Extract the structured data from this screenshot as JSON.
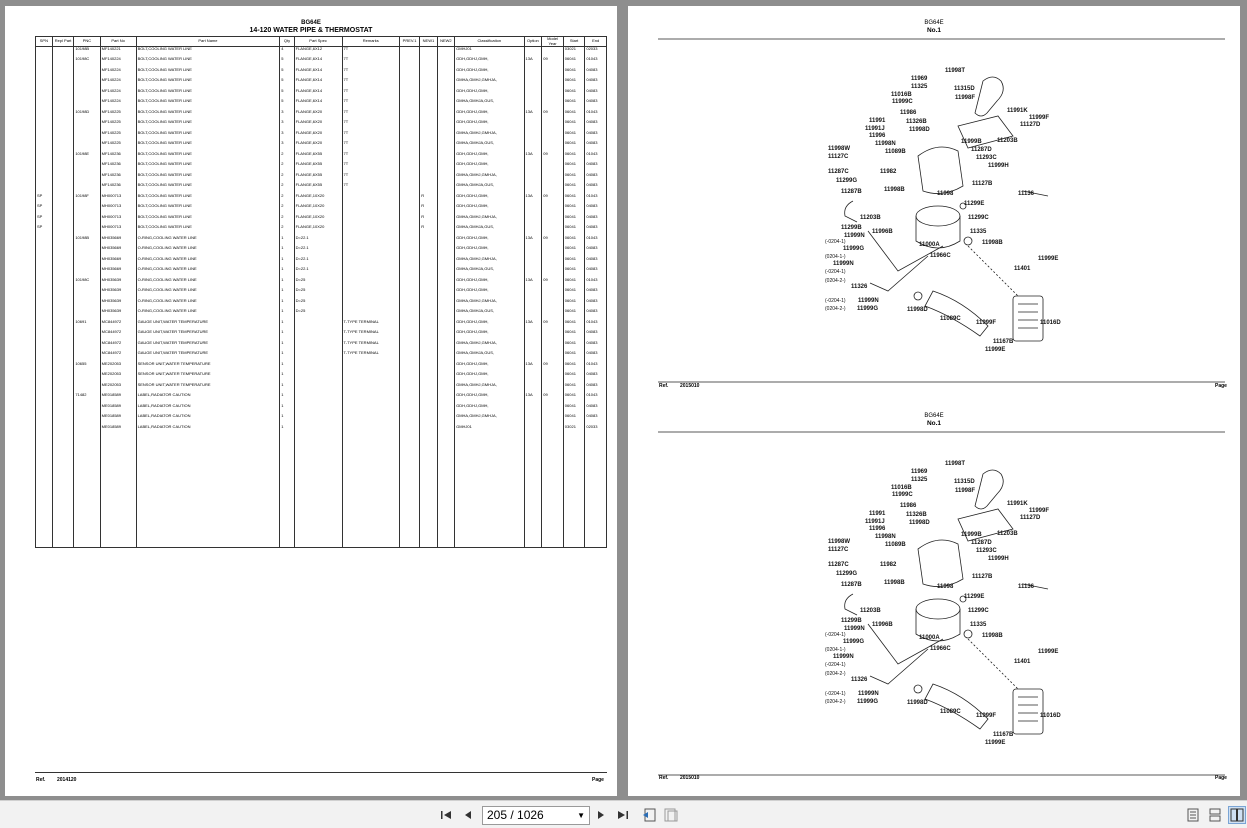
{
  "left_page": {
    "code": "BG64E",
    "title": "14-120 WATER PIPE & THERMOSTAT",
    "columns": [
      "SPN",
      "Repl Part",
      "PNC",
      "Part No",
      "Part Name",
      "Qty",
      "Part Spec",
      "Remarks",
      "PREV.1",
      "NEW1",
      "NEW2",
      "Classification",
      "Option",
      "Model Year",
      "Start",
      "End"
    ],
    "rows": [
      [
        "",
        "",
        "10198B",
        "MF140221",
        "BOLT,COOLING WATER LINE",
        "4",
        "FLANGE,6X12",
        "7T",
        "",
        "",
        "",
        "GMHJ01",
        "",
        "",
        "03021",
        "02033"
      ],
      [
        "",
        "",
        "10198C",
        "MF140224",
        "BOLT,COOLING WATER LINE",
        "5",
        "FLANGE,6X14",
        "7T",
        "",
        "",
        "",
        "GDH,GDHJ,GMH,",
        "13A",
        "09",
        "06041",
        "01043"
      ],
      [
        "",
        "",
        "",
        "MF140224",
        "BOLT,COOLING WATER LINE",
        "5",
        "FLANGE,6X14",
        "7T",
        "",
        "",
        "",
        "GDH,GDHJ,GMH,",
        "",
        "",
        "06041",
        "04083"
      ],
      [
        "",
        "",
        "",
        "MF140224",
        "BOLT,COOLING WATER LINE",
        "5",
        "FLANGE,6X14",
        "7T",
        "",
        "",
        "",
        "GMHA,GMHJ,GMHJA,",
        "",
        "",
        "06041",
        "04083"
      ],
      [
        "",
        "",
        "",
        "MF140224",
        "BOLT,COOLING WATER LINE",
        "5",
        "FLANGE,6X14",
        "7T",
        "",
        "",
        "",
        "GDH,GDHJ,GMH,",
        "",
        "",
        "06041",
        "04083"
      ],
      [
        "",
        "",
        "",
        "MF140224",
        "BOLT,COOLING WATER LINE",
        "5",
        "FLANGE,6X14",
        "7T",
        "",
        "",
        "",
        "GMHA,GMHJA,GUS,",
        "",
        "",
        "06041",
        "04083"
      ],
      [
        "",
        "",
        "10198D",
        "MF140225",
        "BOLT,COOLING WATER LINE",
        "3",
        "FLANGE,6X20",
        "7T",
        "",
        "",
        "",
        "GDH,GDHJ,GMH,",
        "13A",
        "09",
        "06041",
        "01043"
      ],
      [
        "",
        "",
        "",
        "MF140225",
        "BOLT,COOLING WATER LINE",
        "3",
        "FLANGE,6X20",
        "7T",
        "",
        "",
        "",
        "GDH,GDHJ,GMH,",
        "",
        "",
        "06041",
        "04083"
      ],
      [
        "",
        "",
        "",
        "MF140225",
        "BOLT,COOLING WATER LINE",
        "3",
        "FLANGE,6X20",
        "7T",
        "",
        "",
        "",
        "GMHA,GMHJ,GMHJA,",
        "",
        "",
        "06041",
        "04083"
      ],
      [
        "",
        "",
        "",
        "MF140225",
        "BOLT,COOLING WATER LINE",
        "3",
        "FLANGE,6X20",
        "7T",
        "",
        "",
        "",
        "GMHA,GMHJA,GUS,",
        "",
        "",
        "06041",
        "04083"
      ],
      [
        "",
        "",
        "10198E",
        "MF140236",
        "BOLT,COOLING WATER LINE",
        "2",
        "FLANGE,6X55",
        "7T",
        "",
        "",
        "",
        "GDH,GDHJ,GMH,",
        "13A",
        "09",
        "06041",
        "01043"
      ],
      [
        "",
        "",
        "",
        "MF140236",
        "BOLT,COOLING WATER LINE",
        "2",
        "FLANGE,6X55",
        "7T",
        "",
        "",
        "",
        "GDH,GDHJ,GMH,",
        "",
        "",
        "06041",
        "04083"
      ],
      [
        "",
        "",
        "",
        "MF140236",
        "BOLT,COOLING WATER LINE",
        "2",
        "FLANGE,6X55",
        "7T",
        "",
        "",
        "",
        "GMHA,GMHJ,GMHJA,",
        "",
        "",
        "06041",
        "04083"
      ],
      [
        "",
        "",
        "",
        "MF140236",
        "BOLT,COOLING WATER LINE",
        "2",
        "FLANGE,6X55",
        "7T",
        "",
        "",
        "",
        "GMHA,GMHJA,GUS,",
        "",
        "",
        "06041",
        "04083"
      ],
      [
        "SP",
        "",
        "10198F",
        "MH000713",
        "BOLT,COOLING WATER LINE",
        "2",
        "FLANGE,10X20",
        "",
        "",
        "R",
        "",
        "GDH,GDHJ,GMH,",
        "13A",
        "09",
        "06041",
        "01043"
      ],
      [
        "SP",
        "",
        "",
        "MH000713",
        "BOLT,COOLING WATER LINE",
        "2",
        "FLANGE,10X20",
        "",
        "",
        "R",
        "",
        "GDH,GDHJ,GMH,",
        "",
        "",
        "06041",
        "04083"
      ],
      [
        "SP",
        "",
        "",
        "MH000713",
        "BOLT,COOLING WATER LINE",
        "2",
        "FLANGE,10X20",
        "",
        "",
        "R",
        "",
        "GMHA,GMHJ,GMHJA,",
        "",
        "",
        "06041",
        "04083"
      ],
      [
        "SP",
        "",
        "",
        "MH000713",
        "BOLT,COOLING WATER LINE",
        "2",
        "FLANGE,10X20",
        "",
        "",
        "R",
        "",
        "GMHA,GMHJA,GUS,",
        "",
        "",
        "06041",
        "04083"
      ],
      [
        "",
        "",
        "10198B",
        "MH035669",
        "O-RING,COOLING WATER LINE",
        "1",
        "D=22.1",
        "",
        "",
        "",
        "",
        "GDH,GDHJ,GMH,",
        "13A",
        "09",
        "06041",
        "01043"
      ],
      [
        "",
        "",
        "",
        "MH035669",
        "O-RING,COOLING WATER LINE",
        "1",
        "D=22.1",
        "",
        "",
        "",
        "",
        "GDH,GDHJ,GMH,",
        "",
        "",
        "06041",
        "04083"
      ],
      [
        "",
        "",
        "",
        "MH035669",
        "O-RING,COOLING WATER LINE",
        "1",
        "D=22.1",
        "",
        "",
        "",
        "",
        "GMHA,GMHJ,GMHJA,",
        "",
        "",
        "06041",
        "04083"
      ],
      [
        "",
        "",
        "",
        "MH035669",
        "O-RING,COOLING WATER LINE",
        "1",
        "D=22.1",
        "",
        "",
        "",
        "",
        "GMHA,GMHJA,GUS,",
        "",
        "",
        "06041",
        "04083"
      ],
      [
        "",
        "",
        "10198C",
        "MH035639",
        "O-RING,COOLING WATER LINE",
        "1",
        "D=25",
        "",
        "",
        "",
        "",
        "GDH,GDHJ,GMH,",
        "13A",
        "09",
        "06041",
        "01043"
      ],
      [
        "",
        "",
        "",
        "MH035639",
        "O-RING,COOLING WATER LINE",
        "1",
        "D=25",
        "",
        "",
        "",
        "",
        "GDH,GDHJ,GMH,",
        "",
        "",
        "06041",
        "04083"
      ],
      [
        "",
        "",
        "",
        "MH035639",
        "O-RING,COOLING WATER LINE",
        "1",
        "D=25",
        "",
        "",
        "",
        "",
        "GMHA,GMHJ,GMHJA,",
        "",
        "",
        "06041",
        "04083"
      ],
      [
        "",
        "",
        "",
        "MH035639",
        "O-RING,COOLING WATER LINE",
        "1",
        "D=25",
        "",
        "",
        "",
        "",
        "GMHA,GMHJA,GUS,",
        "",
        "",
        "06041",
        "04083"
      ],
      [
        "",
        "",
        "10691",
        "MC844972",
        "GAUGE UNIT,WATER TEMPERATURE",
        "1",
        "",
        "T-TYPE TERMINAL",
        "",
        "",
        "",
        "GDH,GDHJ,GMH,",
        "13A",
        "09",
        "06041",
        "01043"
      ],
      [
        "",
        "",
        "",
        "MC844972",
        "GAUGE UNIT,WATER TEMPERATURE",
        "1",
        "",
        "T-TYPE TERMINAL",
        "",
        "",
        "",
        "GDH,GDHJ,GMH,",
        "",
        "",
        "06041",
        "04083"
      ],
      [
        "",
        "",
        "",
        "MC844972",
        "GAUGE UNIT,WATER TEMPERATURE",
        "1",
        "",
        "T-TYPE TERMINAL",
        "",
        "",
        "",
        "GMHA,GMHJ,GMHJA,",
        "",
        "",
        "06041",
        "04083"
      ],
      [
        "",
        "",
        "",
        "MC844972",
        "GAUGE UNIT,WATER TEMPERATURE",
        "1",
        "",
        "T-TYPE TERMINAL",
        "",
        "",
        "",
        "GMHA,GMHJA,GUS,",
        "",
        "",
        "06041",
        "04083"
      ],
      [
        "",
        "",
        "10655",
        "ME202053",
        "SENSOR UNIT,WATER TEMPERATURE",
        "1",
        "",
        "",
        "",
        "",
        "",
        "GDH,GDHJ,GMH,",
        "13A",
        "09",
        "06041",
        "01043"
      ],
      [
        "",
        "",
        "",
        "ME202053",
        "SENSOR UNIT,WATER TEMPERATURE",
        "1",
        "",
        "",
        "",
        "",
        "",
        "GDH,GDHJ,GMH,",
        "",
        "",
        "06041",
        "04083"
      ],
      [
        "",
        "",
        "",
        "ME202053",
        "SENSOR UNIT,WATER TEMPERATURE",
        "1",
        "",
        "",
        "",
        "",
        "",
        "GMHA,GMHJ,GMHJA,",
        "",
        "",
        "06041",
        "04083"
      ],
      [
        "",
        "",
        "71482",
        "ME018589",
        "LABEL,RADIATOR CAUTION",
        "1",
        "",
        "",
        "",
        "",
        "",
        "GDH,GDHJ,GMH,",
        "13A",
        "09",
        "06041",
        "01043"
      ],
      [
        "",
        "",
        "",
        "ME018589",
        "LABEL,RADIATOR CAUTION",
        "1",
        "",
        "",
        "",
        "",
        "",
        "GDH,GDHJ,GMH,",
        "",
        "",
        "06041",
        "04083"
      ],
      [
        "",
        "",
        "",
        "ME018589",
        "LABEL,RADIATOR CAUTION",
        "1",
        "",
        "",
        "",
        "",
        "",
        "GMHA,GMHJ,GMHJA,",
        "",
        "",
        "06041",
        "04083"
      ],
      [
        "",
        "",
        "",
        "ME018589",
        "LABEL,RADIATOR CAUTION",
        "1",
        "",
        "",
        "",
        "",
        "",
        "GMHJ01",
        "",
        "",
        "03021",
        "02033"
      ]
    ],
    "ref_label": "Ref.",
    "ref_value": "2014120",
    "page_label": "Page"
  },
  "right_page": {
    "diagrams": [
      {
        "code": "BG64E",
        "no": "No.1",
        "callouts": [
          "11998T",
          "11969",
          "11325",
          "11315D",
          "11016B",
          "11998F",
          "11999C",
          "11991K",
          "11986",
          "11999F",
          "11127D",
          "11991",
          "11326B",
          "11991J",
          "11998D",
          "11996",
          "11999B",
          "11998N",
          "11203B",
          "11998W",
          "11287D",
          "11089B",
          "11127C",
          "11293C",
          "11999H",
          "11287C",
          "11982",
          "11299G",
          "11127B",
          "11287B",
          "11998B",
          "11998",
          "11136",
          "11299E",
          "11203B",
          "11299C",
          "11299B",
          "11999N",
          "11996B",
          "11335",
          "11999G",
          "11998B",
          "11000A",
          "11966C",
          "11999E",
          "11999N",
          "11401",
          "11326",
          "11999N",
          "11999G",
          "11998D",
          "11089C",
          "11999F",
          "11016D",
          "11167B",
          "11999E"
        ],
        "small_text": [
          "(-0204-1)",
          "(0204-1-)",
          "(-0204-1)",
          "(0204-2-)",
          "(-0204-1)",
          "(0204-2-)"
        ],
        "ref_label": "Ref.",
        "ref_value": "2015010",
        "page_label": "Page"
      },
      {
        "code": "BG64E",
        "no": "No.1",
        "ref_label": "Ref.",
        "ref_value": "2015010",
        "page_label": "Page"
      }
    ]
  },
  "toolbar": {
    "page_indicator": "205 / 1026"
  }
}
